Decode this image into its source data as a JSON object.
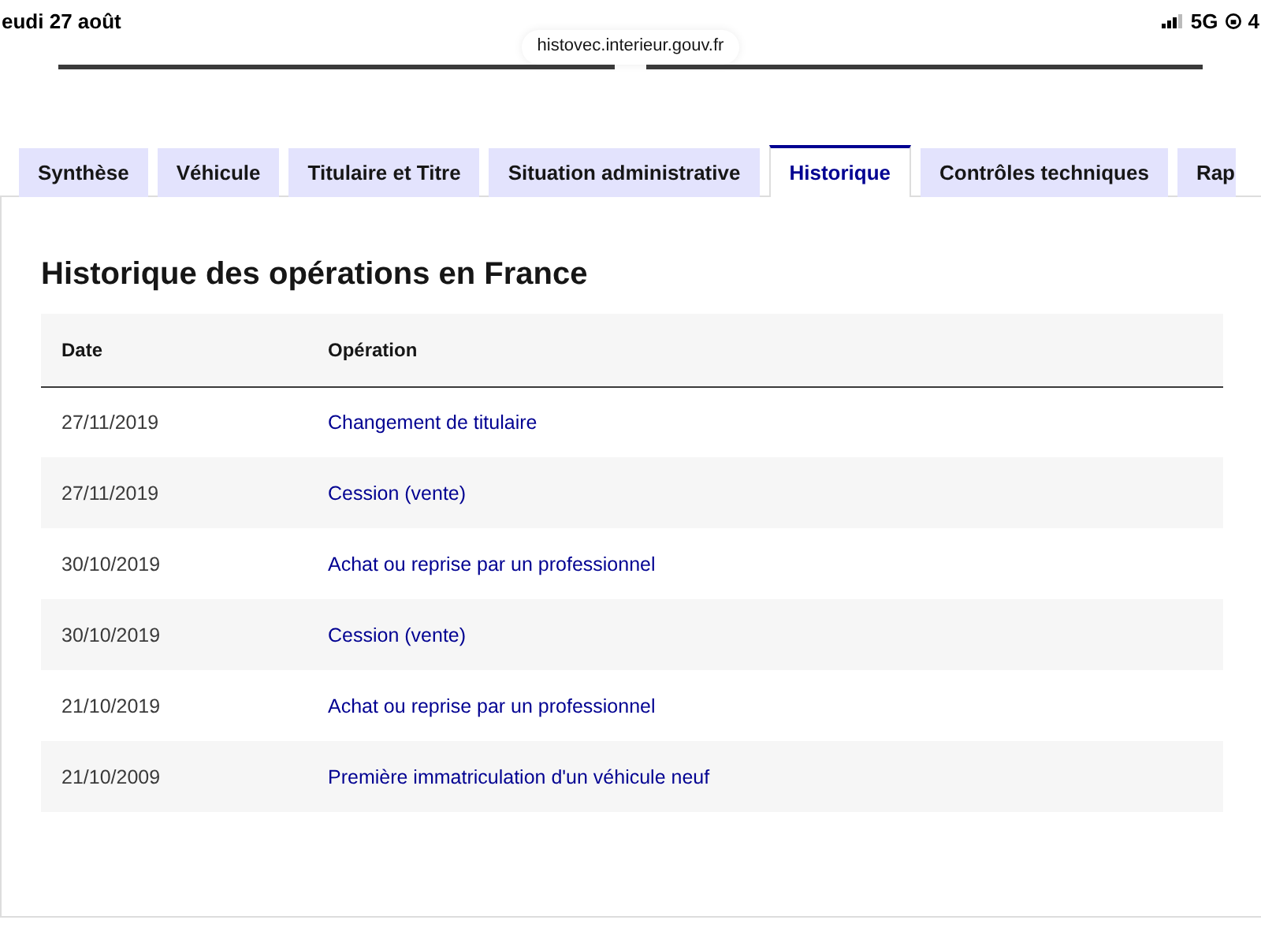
{
  "status_bar": {
    "date": "eudi 27 août",
    "network": "5G",
    "battery": "4"
  },
  "address_bar": {
    "url": "histovec.interieur.gouv.fr"
  },
  "tabs": [
    {
      "label": "Synthèse",
      "selected": false
    },
    {
      "label": "Véhicule",
      "selected": false
    },
    {
      "label": "Titulaire et Titre",
      "selected": false
    },
    {
      "label": "Situation administrative",
      "selected": false
    },
    {
      "label": "Historique",
      "selected": true
    },
    {
      "label": "Contrôles techniques",
      "selected": false
    },
    {
      "label": "Rap",
      "selected": false
    }
  ],
  "section": {
    "title": "Historique des opérations en France"
  },
  "table": {
    "columns": [
      "Date",
      "Opération"
    ],
    "rows": [
      [
        "27/11/2019",
        "Changement de titulaire"
      ],
      [
        "27/11/2019",
        "Cession (vente)"
      ],
      [
        "30/10/2019",
        "Achat ou reprise par un professionnel"
      ],
      [
        "30/10/2019",
        "Cession (vente)"
      ],
      [
        "21/10/2019",
        "Achat ou reprise par un professionnel"
      ],
      [
        "21/10/2009",
        "Première immatriculation d'un véhicule neuf"
      ]
    ]
  }
}
